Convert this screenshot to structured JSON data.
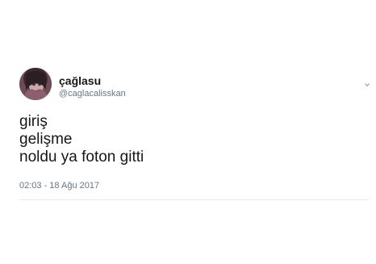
{
  "tweet": {
    "display_name": "çağlasu",
    "handle": "@caglacalisskan",
    "lines": [
      "giriş",
      "gelişme",
      "noldu ya foton gitti"
    ],
    "timestamp": "02:03 - 18 Ağu 2017"
  },
  "icons": {
    "avatar": "profile-photo",
    "menu": "chevron-down-icon"
  },
  "colors": {
    "text_primary": "#14171a",
    "text_secondary": "#657786",
    "divider": "#e6ecf0",
    "background": "#ffffff"
  }
}
